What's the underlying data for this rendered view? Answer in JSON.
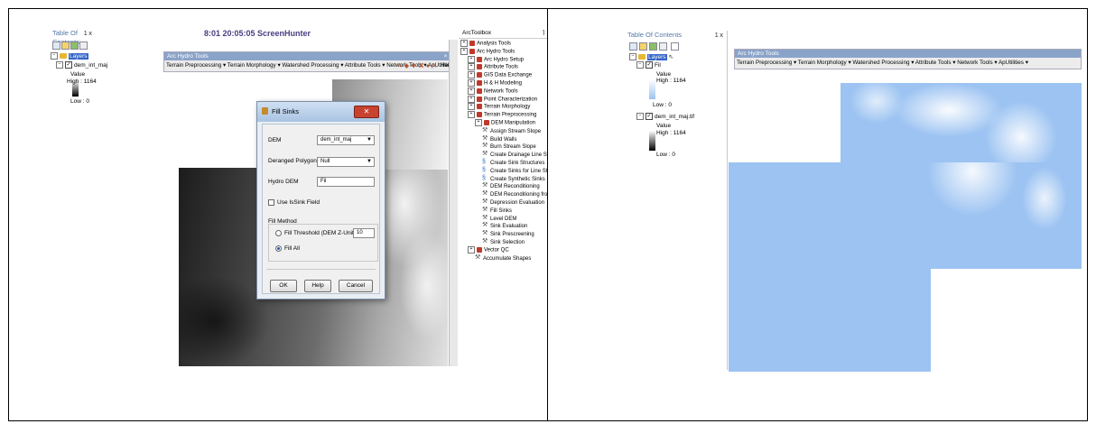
{
  "left": {
    "partial_title": "8:01 20:05:05 ScreenHunter",
    "toc": {
      "title": "Table Of Contents",
      "pin": " 1 x",
      "layers_label": "Layers",
      "layer_name": "dem_int_maj",
      "value_label": "Value",
      "high_label": "High : 1164",
      "low_label": "Low : 0"
    },
    "arc_hydro_toolbar": {
      "title": "Arc Hydro Tools",
      "menu_text": "Terrain Preprocessing ▾  Terrain Morphology ▾  Watershed Processing ▾  Attribute Tools ▾  Network Tools ▾  ApUtilities ▾",
      "help": "Help"
    },
    "dialog": {
      "title": "Fill Sinks",
      "close_icon": "✕",
      "dem_label": "DEM",
      "dem_value": "dem_int_maj",
      "deranged_label": "Deranged Polygon",
      "deranged_value": "Null",
      "hydro_dem_label": "Hydro DEM",
      "hydro_dem_value": "Fil",
      "issink_label": "Use IsSink Field",
      "fill_method_label": "Fill Method",
      "threshold_label": "Fill Threshold (DEM Z-Unit)",
      "threshold_value": "10",
      "fill_all_label": "Fill All",
      "ok": "OK",
      "help": "Help",
      "cancel": "Cancel"
    },
    "toolbox": {
      "title": "ArcToolbox",
      "pin": " ⌉",
      "items": [
        {
          "label": "Analysis Tools",
          "level": 0,
          "kind": "box"
        },
        {
          "label": "Arc Hydro Tools",
          "level": 0,
          "kind": "box"
        },
        {
          "label": "Arc Hydro Setup",
          "level": 1,
          "kind": "box"
        },
        {
          "label": "Attribute Tools",
          "level": 1,
          "kind": "box"
        },
        {
          "label": "GIS Data Exchange",
          "level": 1,
          "kind": "box"
        },
        {
          "label": "H & H Modeling",
          "level": 1,
          "kind": "box"
        },
        {
          "label": "Network Tools",
          "level": 1,
          "kind": "box"
        },
        {
          "label": "Point Characterization",
          "level": 1,
          "kind": "box"
        },
        {
          "label": "Terrain Morphology",
          "level": 1,
          "kind": "box"
        },
        {
          "label": "Terrain Preprocessing",
          "level": 1,
          "kind": "box"
        },
        {
          "label": "DEM Manipulation",
          "level": 2,
          "kind": "box"
        },
        {
          "label": "Assign Stream Slope",
          "level": 3,
          "kind": "tool"
        },
        {
          "label": "Build Walls",
          "level": 3,
          "kind": "tool"
        },
        {
          "label": "Burn Stream Slope",
          "level": 3,
          "kind": "tool"
        },
        {
          "label": "Create Drainage Line Structures",
          "level": 3,
          "kind": "tool"
        },
        {
          "label": "Create Sink Structures",
          "level": 3,
          "kind": "script"
        },
        {
          "label": "Create Sinks for Line Structure",
          "level": 3,
          "kind": "script"
        },
        {
          "label": "Create Synthetic Sinks",
          "level": 3,
          "kind": "script"
        },
        {
          "label": "DEM Reconditioning",
          "level": 3,
          "kind": "tool"
        },
        {
          "label": "DEM Reconditioning from Stream",
          "level": 3,
          "kind": "tool"
        },
        {
          "label": "Depression Evaluation",
          "level": 3,
          "kind": "tool"
        },
        {
          "label": "Fill Sinks",
          "level": 3,
          "kind": "tool"
        },
        {
          "label": "Level DEM",
          "level": 3,
          "kind": "tool"
        },
        {
          "label": "Sink Evaluation",
          "level": 3,
          "kind": "tool"
        },
        {
          "label": "Sink Prescreening",
          "level": 3,
          "kind": "tool"
        },
        {
          "label": "Sink Selection",
          "level": 3,
          "kind": "tool"
        },
        {
          "label": "Vector QC",
          "level": 1,
          "kind": "box"
        },
        {
          "label": "Accumulate Shapes",
          "level": 2,
          "kind": "tool"
        }
      ]
    }
  },
  "right": {
    "toc": {
      "title": "Table Of Contents",
      "pin": " 1 x",
      "layers_label": "Layers",
      "fil_layer": "Fil",
      "value_label": "Value",
      "high_label": "High : 1164",
      "low_label": "Low : 0",
      "dem_layer": "dem_int_maj.tif",
      "dem_value_label": "Value",
      "dem_high_label": "High : 1164",
      "dem_low_label": "Low : 0"
    },
    "arc_hydro_toolbar": {
      "title": "Arc Hydro Tools",
      "menu_text": "Terrain Preprocessing ▾  Terrain Morphology ▾  Watershed Processing ▾  Attribute Tools ▾  Network Tools ▾  ApUtilities ▾"
    }
  },
  "colors": {
    "fill_blue": "#9cc3f2",
    "layers_highlight": "#3365c9"
  }
}
